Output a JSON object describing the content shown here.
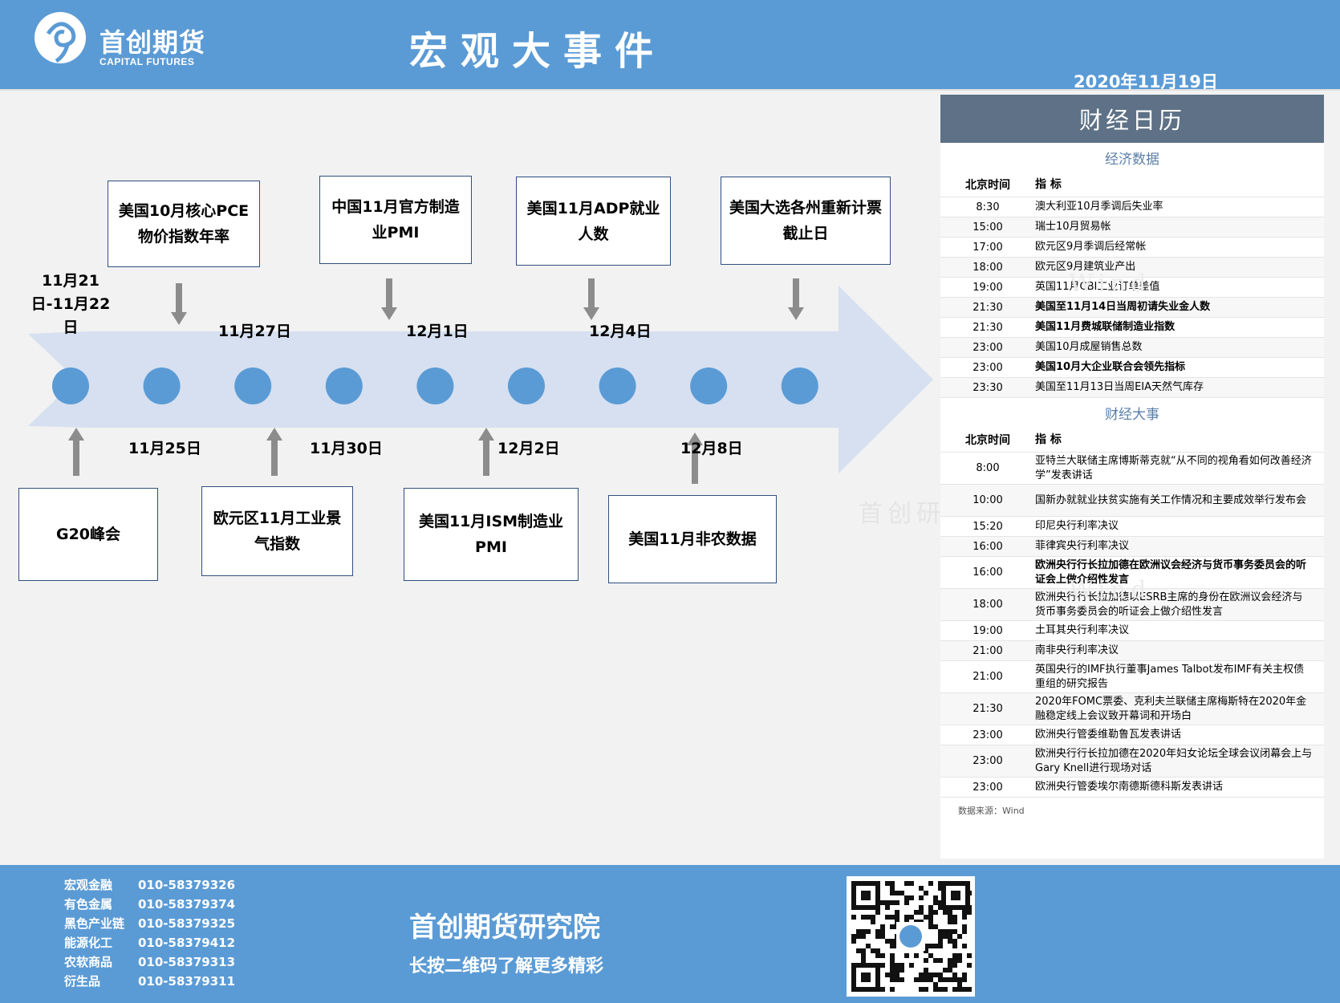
{
  "header": {
    "logo_cn": "首创期货",
    "logo_en": "CAPITAL FUTURES",
    "title": "宏观大事件",
    "date": "2020年11月19日"
  },
  "timeline": {
    "dates": [
      {
        "text": "11月21日-11月22日"
      },
      {
        "text": "11月25日"
      },
      {
        "text": "11月27日"
      },
      {
        "text": "11月30日"
      },
      {
        "text": "12月1日"
      },
      {
        "text": "12月2日"
      },
      {
        "text": "12月4日"
      },
      {
        "text": "12月8日"
      }
    ],
    "events_top": [
      "美国10月核心PCE物价指数年率",
      "中国11月官方制造业PMI",
      "美国11月ADP就业人数",
      "美国大选各州重新计票截止日"
    ],
    "events_bottom": [
      "G20峰会",
      "欧元区11月工业景气指数",
      "美国11月ISM制造业PMI",
      "美国11月非农数据"
    ]
  },
  "calendar": {
    "title": "财经日历",
    "header_time": "北京时间",
    "header_item": "指  标",
    "econ_title": "经济数据",
    "econ": [
      {
        "time": "8:30",
        "item": "澳大利亚10月季调后失业率"
      },
      {
        "time": "15:00",
        "item": "瑞士10月贸易帐"
      },
      {
        "time": "17:00",
        "item": "欧元区9月季调后经常帐"
      },
      {
        "time": "18:00",
        "item": "欧元区9月建筑业产出"
      },
      {
        "time": "19:00",
        "item": "英国11月CBI工业订单差值"
      },
      {
        "time": "21:30",
        "item": "美国至11月14日当周初请失业金人数"
      },
      {
        "time": "21:30",
        "item": "美国11月费城联储制造业指数"
      },
      {
        "time": "23:00",
        "item": "美国10月成屋销售总数"
      },
      {
        "time": "23:00",
        "item": "美国10月大企业联合会领先指标"
      },
      {
        "time": "23:30",
        "item": "美国至11月13日当周EIA天然气库存"
      }
    ],
    "events_title": "财经大事",
    "events": [
      {
        "time": "8:00",
        "item": "亚特兰大联储主席博斯蒂克就“从不同的视角看如何改善经济学”发表讲话"
      },
      {
        "time": "10:00",
        "item": "国新办就就业扶贫实施有关工作情况和主要成效举行发布会"
      },
      {
        "time": "15:20",
        "item": "印尼央行利率决议"
      },
      {
        "time": "16:00",
        "item": "菲律宾央行利率决议"
      },
      {
        "time": "16:00",
        "item": "欧洲央行行长拉加德在欧洲议会经济与货币事务委员会的听证会上做介绍性发言"
      },
      {
        "time": "18:00",
        "item": "欧洲央行行长拉加德以ESRB主席的身份在欧洲议会经济与货币事务委员会的听证会上做介绍性发言"
      },
      {
        "time": "19:00",
        "item": "土耳其央行利率决议"
      },
      {
        "time": "21:00",
        "item": "南非央行利率决议"
      },
      {
        "time": "21:00",
        "item": "英国央行的IMF执行董事James Talbot发布IMF有关主权债重组的研究报告"
      },
      {
        "time": "21:30",
        "item": "2020年FOMC票委、克利夫兰联储主席梅斯特在2020年金融稳定线上会议致开幕词和开场白"
      },
      {
        "time": "23:00",
        "item": "欧洲央行管委维勒鲁瓦发表讲话"
      },
      {
        "time": "23:00",
        "item": "欧洲央行行长拉加德在2020年妇女论坛全球会议闭幕会上与Gary Knell进行现场对话"
      },
      {
        "time": "23:00",
        "item": "欧洲央行管委埃尔南德斯德科斯发表讲话"
      }
    ],
    "source": "数据来源：Wind"
  },
  "footer": {
    "contacts": [
      {
        "dept": "宏观金融",
        "phone": "010-58379326"
      },
      {
        "dept": "有色金属",
        "phone": "010-58379374"
      },
      {
        "dept": "黑色产业链",
        "phone": "010-58379325"
      },
      {
        "dept": "能源化工",
        "phone": "010-58379412"
      },
      {
        "dept": "农软商品",
        "phone": "010-58379313"
      },
      {
        "dept": "衍生品",
        "phone": "010-58379311"
      }
    ],
    "institute": "首创期货研究院",
    "subtitle": "长按二维码了解更多精彩"
  },
  "watermarks": [
    "Wind",
    "首创研"
  ],
  "colors": {
    "brand_blue": "#5b9bd5",
    "arrow": "#d6e0f0",
    "node": "#5b9bd5",
    "panel_header": "#5e7186"
  }
}
